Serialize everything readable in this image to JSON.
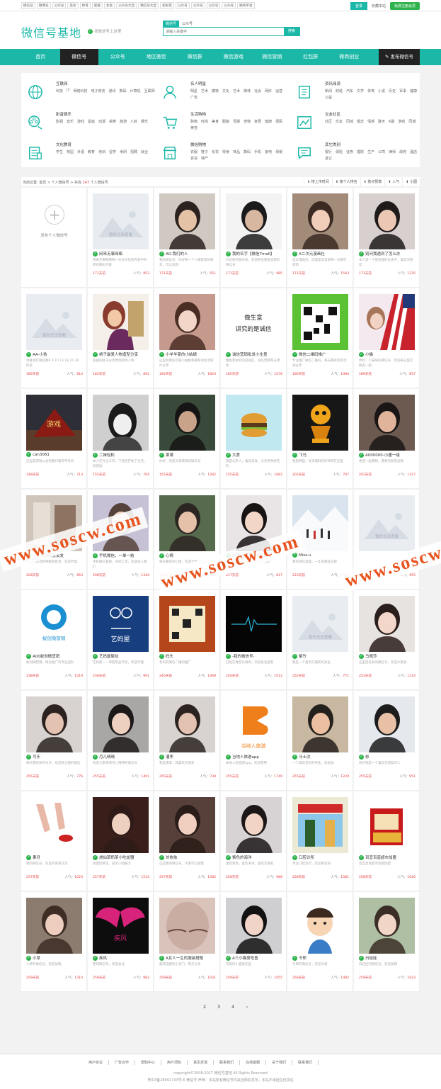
{
  "topbar": {
    "links": [
      "微信号",
      "微博号",
      "公众号",
      "美女",
      "帅哥",
      "星座",
      "女生",
      "公众号大全",
      "微信号大全",
      "加好友",
      "公众号",
      "公众号",
      "公众号",
      "公众号",
      "微商平台"
    ],
    "login": "登录",
    "qq": "收藏本站",
    "register": "免费注册会员"
  },
  "header": {
    "logo": "微信号基地",
    "slogan": "找微信号上这里",
    "search_tabs": [
      "微信号",
      "公众号"
    ],
    "search_placeholder": "请输入关键字",
    "search_button": "搜索"
  },
  "nav": {
    "items": [
      "首页",
      "微信号",
      "公众号",
      "地区微信",
      "微信群",
      "微信游戏",
      "微信营销",
      "红包群",
      "微商创业"
    ],
    "active": 1,
    "publish": "发布微信号"
  },
  "categories": [
    {
      "title": "互联网",
      "subs": [
        "科技",
        "IT",
        "网络科技",
        "电子商务",
        "通讯",
        "数码",
        "计算机",
        "互联网"
      ],
      "icon": "globe-icon"
    },
    {
      "title": "名人明星",
      "subs": [
        "明星",
        "艺术",
        "模特",
        "文化",
        "艺术",
        "媒体",
        "社会",
        "网红",
        "运营",
        "广告"
      ],
      "icon": "person-icon"
    },
    {
      "title": "资讯阅读",
      "subs": [
        "新闻",
        "财经",
        "汽车",
        "文学",
        "体育",
        "小说",
        "历史",
        "军事",
        "健康",
        "公益"
      ],
      "icon": "book-icon"
    },
    {
      "title": "影音娱乐",
      "subs": [
        "影视",
        "音乐",
        "游戏",
        "星座",
        "动漫",
        "搞笑",
        "旅游",
        "八卦",
        "娱乐"
      ],
      "icon": "film-icon"
    },
    {
      "title": "生活购物",
      "subs": [
        "购物",
        "时尚",
        "美食",
        "服装",
        "母婴",
        "宠物",
        "家居",
        "健康",
        "便民",
        "美容"
      ],
      "icon": "cart-icon"
    },
    {
      "title": "交友社区",
      "subs": [
        "社区",
        "交友",
        "同城",
        "婚恋",
        "情感",
        "聊天",
        "K歌",
        "游戏",
        "同城"
      ],
      "icon": "chart-icon"
    },
    {
      "title": "文化教育",
      "subs": [
        "学生",
        "校园",
        "外语",
        "教育",
        "培训",
        "留学",
        "考研",
        "招聘",
        "就业"
      ],
      "icon": "doc-icon"
    },
    {
      "title": "微信购物",
      "subs": [
        "衣服",
        "鞋子",
        "化妆",
        "零食",
        "饰品",
        "数码",
        "手机",
        "家电",
        "母婴",
        "百货",
        "特产"
      ],
      "icon": "shop-icon"
    },
    {
      "title": "其它类别",
      "subs": [
        "银行",
        "保险",
        "证券",
        "理财",
        "生产",
        "公司",
        "律师",
        "政府",
        "酒店",
        "其它"
      ],
      "icon": "message-icon"
    }
  ],
  "sortbar": {
    "crumb_prefix": "当前位置: 首页 > 个人微信号 > 共有",
    "count": "147",
    "crumb_suffix": "个人微信号",
    "sorts": [
      "按上传时间",
      "按个人排名",
      "按点赞数",
      "人气",
      "小图"
    ]
  },
  "add_card": "发布个人微信号",
  "cards": [
    {
      "name": "闲来无事网络",
      "desc": "闲来无事网络每一天分享优质内容中的所有精彩内容",
      "days": "171天前",
      "hits": "853",
      "img": "placeholder"
    },
    {
      "name": "AO.我们的人",
      "desc": "我的微信号：你好每一个人都是我的朋友，可以加我",
      "days": "171天前",
      "hits": "551",
      "img": "man1"
    },
    {
      "name": "我的名字【微信7mall】",
      "desc": "为优质的服务商，欢迎各位朋友加我的微信号",
      "days": "171天前",
      "hits": "985",
      "img": "man2"
    },
    {
      "name": "A二次元漫画社",
      "desc": "美女漫画社，动漫美女资源每一天都在更新",
      "days": "171天前",
      "hits": "1543",
      "img": "girl1"
    },
    {
      "name": "别问我遇到了怎么办",
      "desc": "本人是一个很普通的女孩子，喜欢交朋友",
      "days": "171天前",
      "hits": "1335",
      "img": "girl2"
    },
    {
      "name": "AA-小孩",
      "desc": "本群主打微信群8 9 10 13 18 20 26 好友",
      "days": "185天前",
      "hits": "810",
      "img": "placeholder"
    },
    {
      "name": "桃子最爱人物造型分享",
      "desc": "美丽的桃子分享原创游戏人物",
      "days": "185天前",
      "hits": "892",
      "img": "fantasy"
    },
    {
      "name": "小羊羊家的小姑娘",
      "desc": "这里有我的可爱小姑娘和最新的生活照片分享",
      "days": "185天前",
      "hits": "1820",
      "img": "girl3"
    },
    {
      "name": "诚信营销批发小生意",
      "desc": "做生意讲究的是诚信，诚信营销每天更新",
      "days": "185天前",
      "hits": "1076",
      "img": "textcard"
    },
    {
      "name": "微信二维码推广",
      "desc": "专业推广微信二维码，每天都有新的活动分享",
      "days": "186天前",
      "hits": "1084",
      "img": "qr"
    },
    {
      "name": "小猫",
      "desc": "你好，小猫咪的微信号，欢迎来这里交朋友一起",
      "days": "186天前",
      "hits": "857",
      "img": "flag"
    },
    {
      "name": "can3061",
      "desc": "这里是游戏公会招募代理专用号码",
      "days": "148天前",
      "hits": "713",
      "img": "game"
    },
    {
      "name": "二妹轻松",
      "desc": "本人在外企工作，下班后开始了生活，欢迎加",
      "days": "155天前",
      "hits": "764",
      "img": "bw"
    },
    {
      "name": "萧萧",
      "desc": "你好：欢迎大家来我的微信号",
      "days": "155天前",
      "hits": "1282",
      "img": "man3"
    },
    {
      "name": "大食",
      "desc": "我是北京人，喜欢美食，分享各种好吃的",
      "days": "155天前",
      "hits": "1083",
      "img": "burger"
    },
    {
      "name": "飞马",
      "desc": "我是韩国，投资理财的好项目在这里",
      "days": "202天前",
      "hits": "707",
      "img": "trophy"
    },
    {
      "name": "A000000-小唐一级",
      "desc": "希望一起赚钱，需要的朋友加我",
      "days": "203天前",
      "hits": "1317",
      "img": "man4"
    },
    {
      "name": "一手货源服装批发",
      "desc": "本公司主营各种服装批发，欢迎代理",
      "days": "208天前",
      "hits": "853",
      "img": "shop1"
    },
    {
      "name": "手机微信，一单一结",
      "desc": "手机微信兼职，日结工资，欢迎加入我们",
      "days": "208天前",
      "hits": "1344",
      "img": "girl4"
    },
    {
      "name": "心情",
      "desc": "每天都有好心情，欢迎大家一起来",
      "days": "210天前",
      "hits": "942",
      "img": "girl5"
    },
    {
      "name": "东莞金银首饰网络公司",
      "desc": "专业经营金银首饰，欢迎来询价",
      "days": "217天前",
      "hits": "817",
      "img": "girl6"
    },
    {
      "name": "Miss-u",
      "desc": "我在微信里面，一年多都是这样",
      "days": "223天前",
      "hits": "1085",
      "img": "snow"
    },
    {
      "name": "",
      "desc": "",
      "days": "",
      "hits": "955",
      "img": "placeholder"
    },
    {
      "name": "A00蚁创微营销",
      "desc": "蚁创微营销，微信推广的专业团队",
      "days": "238天前",
      "hits": "1019",
      "img": "logo1"
    },
    {
      "name": "艺妈屋婴幼",
      "desc": "艺妈屋——母婴用品专卖，欢迎代理",
      "days": "238天前",
      "hits": "991",
      "img": "logo2"
    },
    {
      "name": "码头",
      "desc": "有码的微信二维码推广",
      "days": "240天前",
      "hits": "1469",
      "img": "qr2"
    },
    {
      "name": "-我的微信号-",
      "desc": "已经在做音乐微商，欢迎各位朋友",
      "days": "240天前",
      "hits": "1012",
      "img": "dark"
    },
    {
      "name": "紫竹",
      "desc": "我是一个喜欢交朋友的女生",
      "days": "252天前",
      "hits": "771",
      "img": "placeholder"
    },
    {
      "name": "马佩莎",
      "desc": "这里是美女的微信号，欢迎大家加",
      "days": "253天前",
      "hits": "1214",
      "img": "girl7"
    },
    {
      "name": "可乐",
      "desc": "每天都有新的分享，欢迎关注我的微信",
      "days": "255天前",
      "hits": "776",
      "img": "girl8"
    },
    {
      "name": "月儿晴晴",
      "desc": "欢迎大家来到月儿晴晴的微信号",
      "days": "255天前",
      "hits": "1401",
      "img": "girl9"
    },
    {
      "name": "潘李",
      "desc": "我是潘李，我喜欢交朋友",
      "days": "255天前",
      "hits": "739",
      "img": "girl8"
    },
    {
      "name": "当地人旅游app",
      "desc": "本地人的旅游app，欢迎使用",
      "days": "255天前",
      "hits": "1749",
      "img": "app"
    },
    {
      "name": "马士汶",
      "desc": "一个喜欢音乐的男生，欢迎加",
      "days": "255天前",
      "hits": "1229",
      "img": "man5"
    },
    {
      "name": "彬",
      "desc": "你好我是一个喜欢交朋友的人",
      "days": "255天前",
      "hits": "951",
      "img": "man6"
    },
    {
      "name": "果月",
      "desc": "我的微信号，欢迎大家来交流",
      "days": "257天前",
      "hits": "1023",
      "img": "hands"
    },
    {
      "name": "烧仙草奶茶小吃加盟",
      "desc": "加盟奶茶店，投资小回报大",
      "days": "257天前",
      "hits": "1514",
      "img": "girl10"
    },
    {
      "name": "刘依依",
      "desc": "这是我的微信号，大家可以加我",
      "days": "257天前",
      "hits": "1382",
      "img": "girl11"
    },
    {
      "name": "紫色的海洋",
      "desc": "喜欢紫色，喜欢海洋，喜欢交朋友",
      "days": "258天前",
      "hits": "986",
      "img": "girl12"
    },
    {
      "name": "口腔诊所",
      "desc": "专业口腔治疗，欢迎来咨询",
      "days": "258天前",
      "hits": "1581",
      "img": "store"
    },
    {
      "name": "百宜百富超市加盟",
      "desc": "百宜百富超市连锁加盟",
      "days": "258天前",
      "hits": "1026",
      "img": "box"
    },
    {
      "name": "小草",
      "desc": "小草的微信号，欢迎加我",
      "days": "259天前",
      "hits": "1310",
      "img": "girl13"
    },
    {
      "name": "疾风",
      "desc": "疾风微信号，欢迎关注",
      "days": "259天前",
      "hits": "983",
      "img": "wings"
    },
    {
      "name": "A女人一生的服装搭配",
      "desc": "服装搭配的小窍门，每天分享",
      "days": "259天前",
      "hits": "1031",
      "img": "blur"
    },
    {
      "name": "A三小猫爱吃鱼",
      "desc": "可爱的小猫爱吃鱼",
      "days": "259天前",
      "hits": "1055",
      "img": "girl14"
    },
    {
      "name": "令郎",
      "desc": "令郎的微信号，欢迎大家",
      "days": "259天前",
      "hits": "1482",
      "img": "cartoon"
    },
    {
      "name": "白娃娃",
      "desc": "白娃娃的微信号，欢迎加我",
      "days": "259天前",
      "hits": "1023",
      "img": "girl15"
    }
  ],
  "watermark": "www.soscw.com",
  "pager": [
    "2",
    "3",
    "4",
    "›"
  ],
  "footer": {
    "links": [
      "用户协议",
      "广告合作",
      "帮助中心",
      "用户须知",
      "意见反馈",
      "联系我们",
      "在线客服",
      "关于我们",
      "联系我们"
    ],
    "copyright": "copyright©2008-2017 微信号基地 All Rights Reserved",
    "icp": "粤ICP备28991743号-6 微信号 声明：本站所有微信号均来自网友发布，本站不承担任何责任"
  }
}
